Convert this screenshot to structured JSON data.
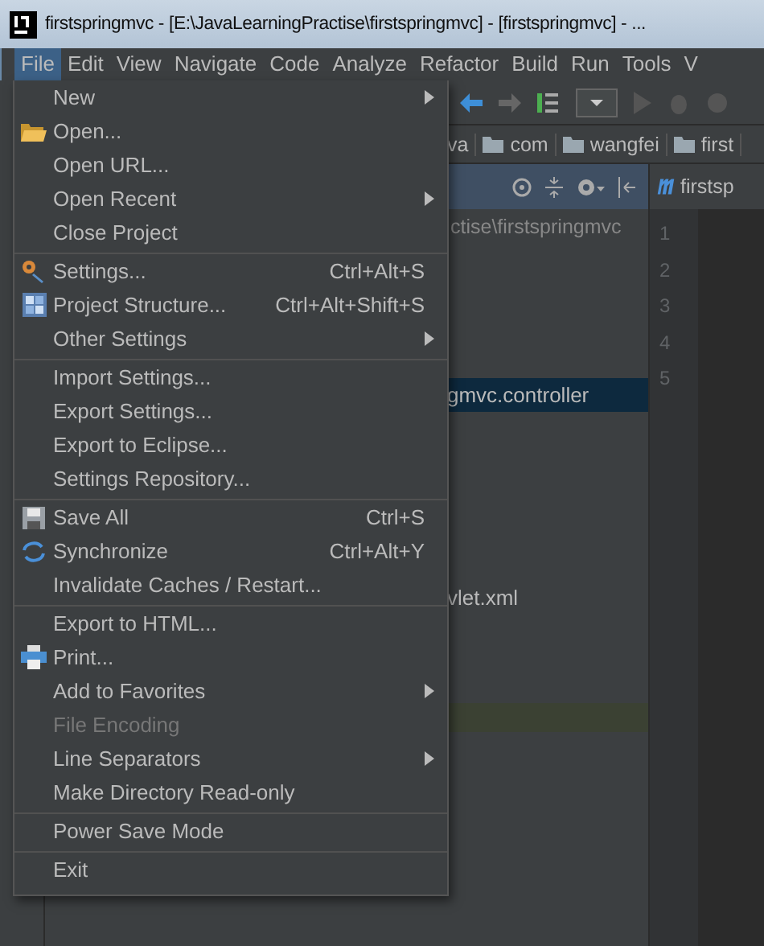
{
  "window": {
    "title": "firstspringmvc - [E:\\JavaLearningPractise\\firstspringmvc] - [firstspringmvc] - ..."
  },
  "menu_bar": [
    {
      "label": "File",
      "selected": true
    },
    {
      "label": "Edit",
      "selected": false
    },
    {
      "label": "View",
      "selected": false
    },
    {
      "label": "Navigate",
      "selected": false
    },
    {
      "label": "Code",
      "selected": false
    },
    {
      "label": "Analyze",
      "selected": false
    },
    {
      "label": "Refactor",
      "selected": false
    },
    {
      "label": "Build",
      "selected": false
    },
    {
      "label": "Run",
      "selected": false
    },
    {
      "label": "Tools",
      "selected": false
    },
    {
      "label": "V",
      "selected": false
    }
  ],
  "file_menu": {
    "groups": [
      {
        "items": [
          {
            "label": "New",
            "submenu": true,
            "disabled": false
          },
          {
            "label": "Open...",
            "kind": "folder",
            "submenu": false,
            "disabled": false
          },
          {
            "label": "Open URL...",
            "submenu": false,
            "disabled": false
          },
          {
            "label": "Open Recent",
            "submenu": true,
            "disabled": false
          },
          {
            "label": "Close Project",
            "submenu": false,
            "disabled": false
          }
        ]
      },
      {
        "items": [
          {
            "label": "Settings...",
            "kind": "settings",
            "shortcut": "Ctrl+Alt+S",
            "submenu": false,
            "disabled": false
          },
          {
            "label": "Project Structure...",
            "kind": "structure",
            "shortcut": "Ctrl+Alt+Shift+S",
            "submenu": false,
            "disabled": false
          },
          {
            "label": "Other Settings",
            "submenu": true,
            "disabled": false
          }
        ]
      },
      {
        "items": [
          {
            "label": "Import Settings...",
            "submenu": false,
            "disabled": false
          },
          {
            "label": "Export Settings...",
            "submenu": false,
            "disabled": false
          },
          {
            "label": "Export to Eclipse...",
            "submenu": false,
            "disabled": false
          },
          {
            "label": "Settings Repository...",
            "submenu": false,
            "disabled": false
          }
        ]
      },
      {
        "items": [
          {
            "label": "Save All",
            "kind": "save",
            "shortcut": "Ctrl+S",
            "submenu": false,
            "disabled": false
          },
          {
            "label": "Synchronize",
            "kind": "sync",
            "shortcut": "Ctrl+Alt+Y",
            "submenu": false,
            "disabled": false
          },
          {
            "label": "Invalidate Caches / Restart...",
            "submenu": false,
            "disabled": false
          }
        ]
      },
      {
        "items": [
          {
            "label": "Export to HTML...",
            "submenu": false,
            "disabled": false
          },
          {
            "label": "Print...",
            "kind": "print",
            "submenu": false,
            "disabled": false
          },
          {
            "label": "Add to Favorites",
            "submenu": true,
            "disabled": false
          },
          {
            "label": "File Encoding",
            "submenu": false,
            "disabled": true
          },
          {
            "label": "Line Separators",
            "submenu": true,
            "disabled": false
          },
          {
            "label": "Make Directory Read-only",
            "submenu": false,
            "disabled": false
          }
        ]
      },
      {
        "items": [
          {
            "label": "Power Save Mode",
            "submenu": false,
            "disabled": false
          }
        ]
      },
      {
        "items": [
          {
            "label": "Exit",
            "submenu": false,
            "disabled": false
          }
        ]
      }
    ]
  },
  "breadcrumbs": [
    "va",
    "com",
    "wangfei",
    "first"
  ],
  "project_panel": {
    "path": "ctise\\firstspringmvc",
    "rows": [
      {
        "label": "gmvc.controller",
        "selected": true
      },
      {
        "label": "vlet.xml",
        "selected": false
      }
    ]
  },
  "editor": {
    "tab": "firstsp",
    "line_numbers": [
      "1",
      "2",
      "3",
      "4",
      "5"
    ]
  }
}
